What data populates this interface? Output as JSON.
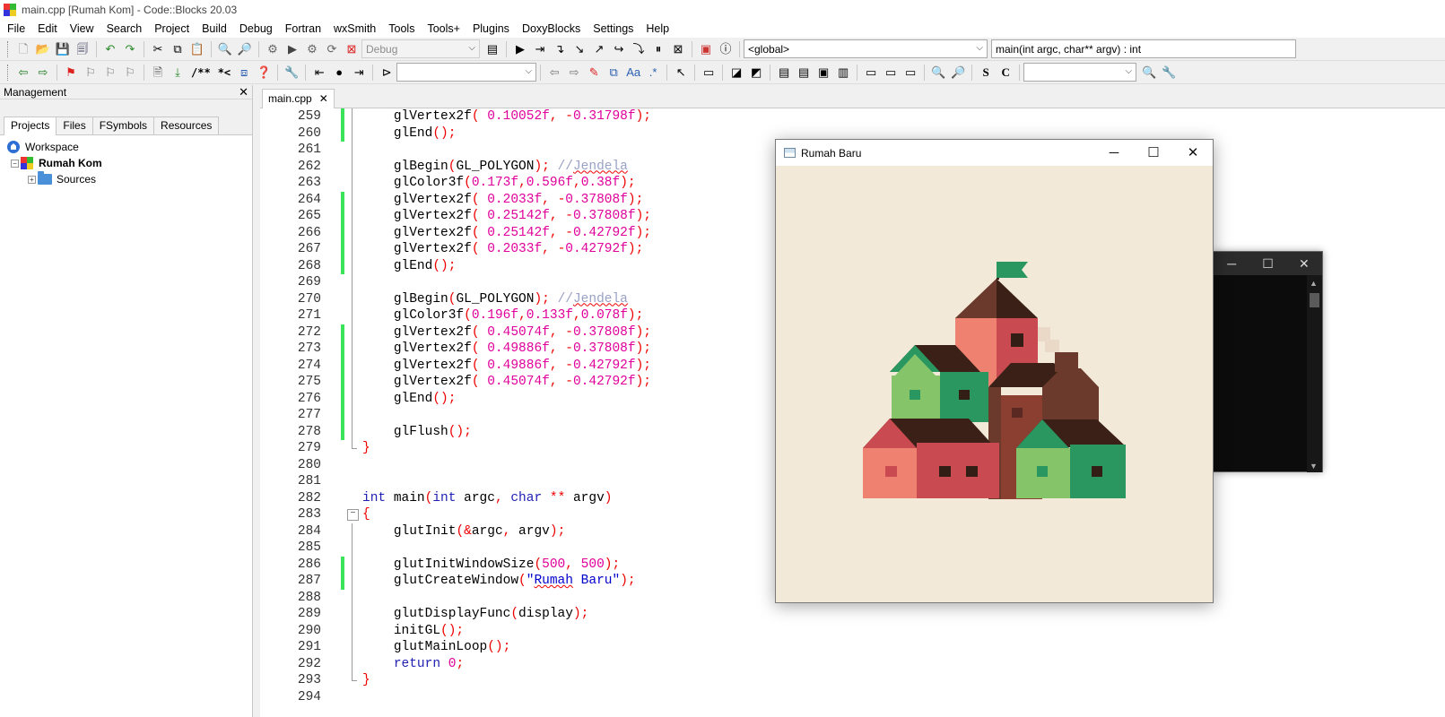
{
  "window": {
    "title": "main.cpp [Rumah Kom] - Code::Blocks 20.03"
  },
  "menu": [
    "File",
    "Edit",
    "View",
    "Search",
    "Project",
    "Build",
    "Debug",
    "Fortran",
    "wxSmith",
    "Tools",
    "Tools+",
    "Plugins",
    "DoxyBlocks",
    "Settings",
    "Help"
  ],
  "toolbar": {
    "build_target": "Debug",
    "scope": "<global>",
    "function": "main(int argc, char** argv) : int",
    "doxy_block": "/**",
    "doxy_line": "*<",
    "search_text": "",
    "symbol_text": ""
  },
  "management": {
    "title": "Management",
    "close": "✕",
    "tabs": [
      "Projects",
      "Files",
      "FSymbols",
      "Resources"
    ],
    "tree": {
      "workspace": "Workspace",
      "project": "Rumah Kom",
      "folder": "Sources"
    }
  },
  "editor": {
    "tab": "main.cpp",
    "tab_close": "✕",
    "lines": [
      {
        "n": "259",
        "m": true,
        "f": "vline",
        "h": "    <span class=fn>glVertex2f</span><span class=pn>(</span> <span class=num>0.10052f</span><span class=pn>,</span> <span class=pn>-</span><span class=num>0.31798f</span><span class=pn>);</span>"
      },
      {
        "n": "260",
        "m": true,
        "f": "vline",
        "h": "    <span class=fn>glEnd</span><span class=pn>();</span>"
      },
      {
        "n": "261",
        "m": false,
        "f": "vline",
        "h": ""
      },
      {
        "n": "262",
        "m": false,
        "f": "vline",
        "h": "    <span class=fn>glBegin</span><span class=pn>(</span>GL_POLYGON<span class=pn>);</span> <span class=cm>//<span class=sq>Jendela</span></span>"
      },
      {
        "n": "263",
        "m": false,
        "f": "vline",
        "h": "    <span class=fn>glColor3f</span><span class=pn>(</span><span class=num>0.173f</span><span class=pn>,</span><span class=num>0.596f</span><span class=pn>,</span><span class=num>0.38f</span><span class=pn>);</span>"
      },
      {
        "n": "264",
        "m": true,
        "f": "vline",
        "h": "    <span class=fn>glVertex2f</span><span class=pn>(</span> <span class=num>0.2033f</span><span class=pn>,</span> <span class=pn>-</span><span class=num>0.37808f</span><span class=pn>);</span>"
      },
      {
        "n": "265",
        "m": true,
        "f": "vline",
        "h": "    <span class=fn>glVertex2f</span><span class=pn>(</span> <span class=num>0.25142f</span><span class=pn>,</span> <span class=pn>-</span><span class=num>0.37808f</span><span class=pn>);</span>"
      },
      {
        "n": "266",
        "m": true,
        "f": "vline",
        "h": "    <span class=fn>glVertex2f</span><span class=pn>(</span> <span class=num>0.25142f</span><span class=pn>,</span> <span class=pn>-</span><span class=num>0.42792f</span><span class=pn>);</span>"
      },
      {
        "n": "267",
        "m": true,
        "f": "vline",
        "h": "    <span class=fn>glVertex2f</span><span class=pn>(</span> <span class=num>0.2033f</span><span class=pn>,</span> <span class=pn>-</span><span class=num>0.42792f</span><span class=pn>);</span>"
      },
      {
        "n": "268",
        "m": true,
        "f": "vline",
        "h": "    <span class=fn>glEnd</span><span class=pn>();</span>"
      },
      {
        "n": "269",
        "m": false,
        "f": "vline",
        "h": ""
      },
      {
        "n": "270",
        "m": false,
        "f": "vline",
        "h": "    <span class=fn>glBegin</span><span class=pn>(</span>GL_POLYGON<span class=pn>);</span> <span class=cm>//<span class=sq>Jendela</span></span>"
      },
      {
        "n": "271",
        "m": false,
        "f": "vline",
        "h": "    <span class=fn>glColor3f</span><span class=pn>(</span><span class=num>0.196f</span><span class=pn>,</span><span class=num>0.133f</span><span class=pn>,</span><span class=num>0.078f</span><span class=pn>);</span>"
      },
      {
        "n": "272",
        "m": true,
        "f": "vline",
        "h": "    <span class=fn>glVertex2f</span><span class=pn>(</span> <span class=num>0.45074f</span><span class=pn>,</span> <span class=pn>-</span><span class=num>0.37808f</span><span class=pn>);</span>"
      },
      {
        "n": "273",
        "m": true,
        "f": "vline",
        "h": "    <span class=fn>glVertex2f</span><span class=pn>(</span> <span class=num>0.49886f</span><span class=pn>,</span> <span class=pn>-</span><span class=num>0.37808f</span><span class=pn>);</span>"
      },
      {
        "n": "274",
        "m": true,
        "f": "vline",
        "h": "    <span class=fn>glVertex2f</span><span class=pn>(</span> <span class=num>0.49886f</span><span class=pn>,</span> <span class=pn>-</span><span class=num>0.42792f</span><span class=pn>);</span>"
      },
      {
        "n": "275",
        "m": true,
        "f": "vline",
        "h": "    <span class=fn>glVertex2f</span><span class=pn>(</span> <span class=num>0.45074f</span><span class=pn>,</span> <span class=pn>-</span><span class=num>0.42792f</span><span class=pn>);</span>"
      },
      {
        "n": "276",
        "m": true,
        "f": "vline",
        "h": "    <span class=fn>glEnd</span><span class=pn>();</span>"
      },
      {
        "n": "277",
        "m": true,
        "f": "vline",
        "h": ""
      },
      {
        "n": "278",
        "m": true,
        "f": "vline",
        "h": "    <span class=fn>glFlush</span><span class=pn>();</span>"
      },
      {
        "n": "279",
        "m": false,
        "f": "end",
        "h": "<span class=pn>}</span>"
      },
      {
        "n": "280",
        "m": false,
        "f": "",
        "h": ""
      },
      {
        "n": "281",
        "m": false,
        "f": "",
        "h": ""
      },
      {
        "n": "282",
        "m": false,
        "f": "",
        "h": "<span class=kw>int</span> <span class=fn>main</span><span class=pn>(</span><span class=kw>int</span> argc<span class=pn>,</span> <span class=kw>char</span> <span class=pn>**</span> argv<span class=pn>)</span>"
      },
      {
        "n": "283",
        "m": false,
        "f": "box",
        "h": "<span class=pn>{</span>"
      },
      {
        "n": "284",
        "m": false,
        "f": "vline",
        "h": "    <span class=fn>glutInit</span><span class=pn>(&amp;</span>argc<span class=pn>,</span> argv<span class=pn>);</span>"
      },
      {
        "n": "285",
        "m": false,
        "f": "vline",
        "h": ""
      },
      {
        "n": "286",
        "m": true,
        "f": "vline",
        "h": "    <span class=fn>glutInitWindowSize</span><span class=pn>(</span><span class=num>500</span><span class=pn>,</span> <span class=num>500</span><span class=pn>);</span>"
      },
      {
        "n": "287",
        "m": true,
        "f": "vline",
        "h": "    <span class=fn>glutCreateWindow</span><span class=pn>(</span><span class=str>\"<span class=sq>Rumah</span> Baru\"</span><span class=pn>);</span>"
      },
      {
        "n": "288",
        "m": false,
        "f": "vline",
        "h": ""
      },
      {
        "n": "289",
        "m": false,
        "f": "vline",
        "h": "    <span class=fn>glutDisplayFunc</span><span class=pn>(</span>display<span class=pn>);</span>"
      },
      {
        "n": "290",
        "m": false,
        "f": "vline",
        "h": "    <span class=fn>initGL</span><span class=pn>();</span>"
      },
      {
        "n": "291",
        "m": false,
        "f": "vline",
        "h": "    <span class=fn>glutMainLoop</span><span class=pn>();</span>"
      },
      {
        "n": "292",
        "m": false,
        "f": "vline",
        "h": "    <span class=kw>return</span> <span class=num>0</span><span class=pn>;</span>"
      },
      {
        "n": "293",
        "m": false,
        "f": "end",
        "h": "<span class=pn>}</span>"
      },
      {
        "n": "294",
        "m": false,
        "f": "",
        "h": ""
      }
    ]
  },
  "gl_window": {
    "title": "Rumah Baru",
    "minimize": "─",
    "maximize": "☐",
    "close": "✕",
    "colors": {
      "background": "#f3e9d9",
      "green_light": "#86c46a",
      "green_dark": "#2a9660",
      "salmon": "#ee8170",
      "red": "#c94a50",
      "brown": "#8a3f30",
      "dark_brown": "#3a2016",
      "roof_brown": "#6b3a2c",
      "window_dark": "#321e14",
      "chimney_cream": "#ead9c7"
    }
  },
  "console": {
    "minimize": "─",
    "maximize": "☐",
    "close": "✕"
  }
}
